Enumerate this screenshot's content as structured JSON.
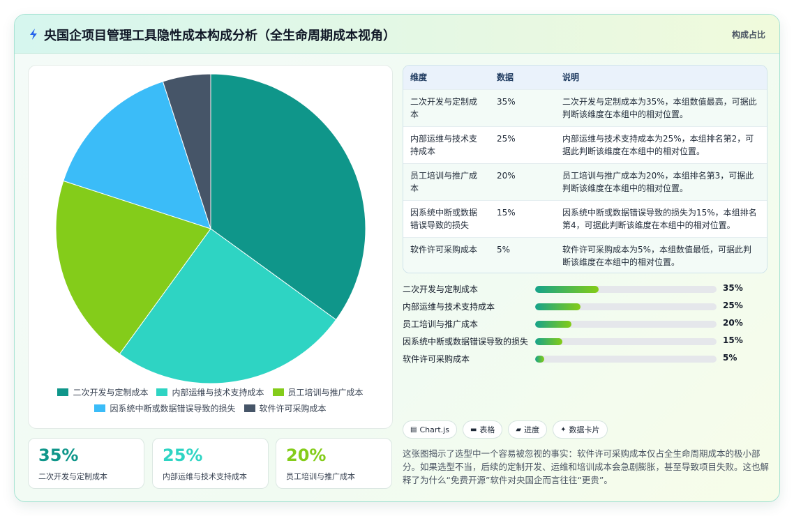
{
  "header": {
    "title": "央国企项目管理工具隐性成本构成分析（全生命周期成本视角）",
    "tag": "构成占比"
  },
  "chart_data": {
    "type": "pie",
    "categories": [
      "二次开发与定制成本",
      "内部运维与技术支持成本",
      "员工培训与推广成本",
      "因系统中断或数据错误导致的损失",
      "软件许可采购成本"
    ],
    "values": [
      35,
      25,
      20,
      15,
      5
    ],
    "colors": [
      "#0f968a",
      "#2ed4c3",
      "#84cc1a",
      "#3bbcf8",
      "#465568"
    ],
    "legend_position": "bottom"
  },
  "stat_cards": [
    {
      "value": "35%",
      "label": "二次开发与定制成本",
      "color": "#0f968a"
    },
    {
      "value": "25%",
      "label": "内部运维与技术支持成本",
      "color": "#2ed4c3"
    },
    {
      "value": "20%",
      "label": "员工培训与推广成本",
      "color": "#84cc1a"
    }
  ],
  "table": {
    "headers": [
      "维度",
      "数据",
      "说明"
    ],
    "rows": [
      {
        "dim": "二次开发与定制成本",
        "value": "35%",
        "desc": "二次开发与定制成本为35%，本组数值最高，可据此判断该维度在本组中的相对位置。"
      },
      {
        "dim": "内部运维与技术支持成本",
        "value": "25%",
        "desc": "内部运维与技术支持成本为25%，本组排名第2，可据此判断该维度在本组中的相对位置。"
      },
      {
        "dim": "员工培训与推广成本",
        "value": "20%",
        "desc": "员工培训与推广成本为20%，本组排名第3，可据此判断该维度在本组中的相对位置。"
      },
      {
        "dim": "因系统中断或数据错误导致的损失",
        "value": "15%",
        "desc": "因系统中断或数据错误导致的损失为15%，本组排名第4，可据此判断该维度在本组中的相对位置。"
      },
      {
        "dim": "软件许可采购成本",
        "value": "5%",
        "desc": "软件许可采购成本为5%，本组数值最低，可据此判断该维度在本组中的相对位置。"
      }
    ]
  },
  "bars": [
    {
      "label": "二次开发与定制成本",
      "value": 35,
      "pct": "35%"
    },
    {
      "label": "内部运维与技术支持成本",
      "value": 25,
      "pct": "25%"
    },
    {
      "label": "员工培训与推广成本",
      "value": 20,
      "pct": "20%"
    },
    {
      "label": "因系统中断或数据错误导致的损失",
      "value": 15,
      "pct": "15%"
    },
    {
      "label": "软件许可采购成本",
      "value": 5,
      "pct": "5%"
    }
  ],
  "chips": [
    {
      "icon": "▤",
      "label": "Chart.js",
      "icon_name": "chart-icon"
    },
    {
      "icon": "▬",
      "label": "表格",
      "icon_name": "table-icon"
    },
    {
      "icon": "▰",
      "label": "进度",
      "icon_name": "progress-icon"
    },
    {
      "icon": "✦",
      "label": "数据卡片",
      "icon_name": "sparkle-icon"
    }
  ],
  "summary": "这张图揭示了选型中一个容易被忽视的事实：软件许可采购成本仅占全生命周期成本的极小部分。如果选型不当，后续的定制开发、运维和培训成本会急剧膨胀，甚至导致项目失败。这也解释了为什么“免费开源”软件对央国企而言往往“更贵”。"
}
